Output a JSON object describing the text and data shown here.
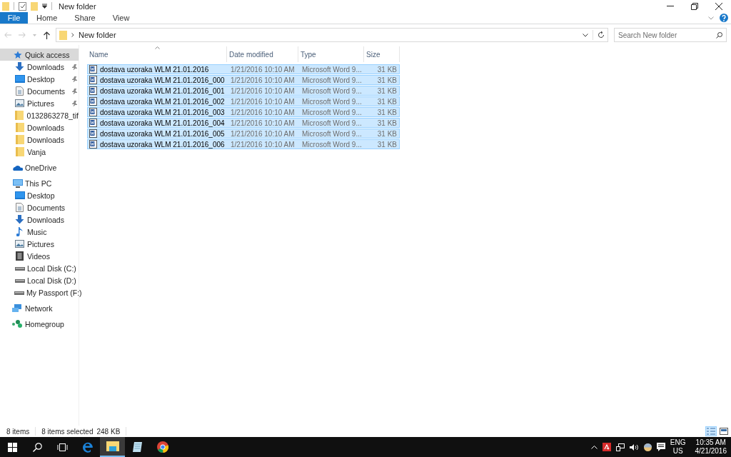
{
  "window": {
    "title": "New folder"
  },
  "ribbon_tabs": [
    {
      "label": "File",
      "kind": "file",
      "selected": false
    },
    {
      "label": "Home",
      "kind": "tab",
      "selected": false
    },
    {
      "label": "Share",
      "kind": "tab",
      "selected": false
    },
    {
      "label": "View",
      "kind": "tab",
      "selected": false
    }
  ],
  "address_bar": {
    "path": "New folder"
  },
  "search": {
    "placeholder": "Search New folder"
  },
  "nav_pane": {
    "items": [
      {
        "label": "Quick access",
        "kind": "star",
        "selected": true,
        "children": [
          {
            "label": "Downloads",
            "kind": "download",
            "pinned": true,
            "selected": false
          },
          {
            "label": "Desktop",
            "kind": "desktop",
            "pinned": true,
            "selected": false
          },
          {
            "label": "Documents",
            "kind": "documents",
            "pinned": true,
            "selected": false
          },
          {
            "label": "Pictures",
            "kind": "pictures",
            "pinned": true,
            "selected": false
          },
          {
            "label": "0132863278_tif",
            "kind": "folder",
            "pinned": false,
            "selected": false
          },
          {
            "label": "Downloads",
            "kind": "folder",
            "pinned": false,
            "selected": false
          },
          {
            "label": "Downloads",
            "kind": "folder",
            "pinned": false,
            "selected": false
          },
          {
            "label": "Vanja",
            "kind": "folder",
            "pinned": false,
            "selected": false
          }
        ]
      },
      {
        "label": "OneDrive",
        "kind": "cloud",
        "selected": false
      },
      {
        "label": "This PC",
        "kind": "pc",
        "selected": false,
        "children": [
          {
            "label": "Desktop",
            "kind": "desktop",
            "pinned": false,
            "selected": false
          },
          {
            "label": "Documents",
            "kind": "documents",
            "pinned": false,
            "selected": false
          },
          {
            "label": "Downloads",
            "kind": "download",
            "pinned": false,
            "selected": false
          },
          {
            "label": "Music",
            "kind": "music",
            "pinned": false,
            "selected": false
          },
          {
            "label": "Pictures",
            "kind": "pictures",
            "pinned": false,
            "selected": false
          },
          {
            "label": "Videos",
            "kind": "videos",
            "pinned": false,
            "selected": false
          },
          {
            "label": "Local Disk (C:)",
            "kind": "drive",
            "pinned": false,
            "selected": false
          },
          {
            "label": "Local Disk (D:)",
            "kind": "drive",
            "pinned": false,
            "selected": false
          },
          {
            "label": "My Passport (F:)",
            "kind": "drive",
            "pinned": false,
            "selected": false
          }
        ]
      },
      {
        "label": "Network",
        "kind": "network",
        "selected": false
      },
      {
        "label": "Homegroup",
        "kind": "homegroup",
        "selected": false
      }
    ]
  },
  "file_list": {
    "columns": [
      {
        "label": "Name",
        "sorted": true
      },
      {
        "label": "Date modified",
        "sorted": false
      },
      {
        "label": "Type",
        "sorted": false
      },
      {
        "label": "Size",
        "sorted": false
      }
    ],
    "rows": [
      {
        "name": "dostava uzoraka WLM 21.01.2016",
        "date": "1/21/2016 10:10 AM",
        "type": "Microsoft Word 9...",
        "size": "31 KB",
        "selected": true
      },
      {
        "name": "dostava uzoraka WLM 21.01.2016_000",
        "date": "1/21/2016 10:10 AM",
        "type": "Microsoft Word 9...",
        "size": "31 KB",
        "selected": true
      },
      {
        "name": "dostava uzoraka WLM 21.01.2016_001",
        "date": "1/21/2016 10:10 AM",
        "type": "Microsoft Word 9...",
        "size": "31 KB",
        "selected": true
      },
      {
        "name": "dostava uzoraka WLM 21.01.2016_002",
        "date": "1/21/2016 10:10 AM",
        "type": "Microsoft Word 9...",
        "size": "31 KB",
        "selected": true
      },
      {
        "name": "dostava uzoraka WLM 21.01.2016_003",
        "date": "1/21/2016 10:10 AM",
        "type": "Microsoft Word 9...",
        "size": "31 KB",
        "selected": true
      },
      {
        "name": "dostava uzoraka WLM 21.01.2016_004",
        "date": "1/21/2016 10:10 AM",
        "type": "Microsoft Word 9...",
        "size": "31 KB",
        "selected": true
      },
      {
        "name": "dostava uzoraka WLM 21.01.2016_005",
        "date": "1/21/2016 10:10 AM",
        "type": "Microsoft Word 9...",
        "size": "31 KB",
        "selected": true
      },
      {
        "name": "dostava uzoraka WLM 21.01.2016_006",
        "date": "1/21/2016 10:10 AM",
        "type": "Microsoft Word 9...",
        "size": "31 KB",
        "selected": true
      }
    ]
  },
  "status_bar": {
    "item_count": "8 items",
    "selection": "8 items selected",
    "selection_size": "248 KB"
  },
  "view_buttons": [
    {
      "kind": "details",
      "selected": true
    },
    {
      "kind": "thumbnails",
      "selected": false
    }
  ],
  "taskbar": {
    "apps": [
      {
        "kind": "edge",
        "active": false
      },
      {
        "kind": "explorer",
        "active": true
      },
      {
        "kind": "notes",
        "active": false
      },
      {
        "kind": "chrome",
        "active": false
      }
    ],
    "language": "ENG",
    "region": "US",
    "time": "10:35 AM",
    "date": "4/21/2016"
  }
}
